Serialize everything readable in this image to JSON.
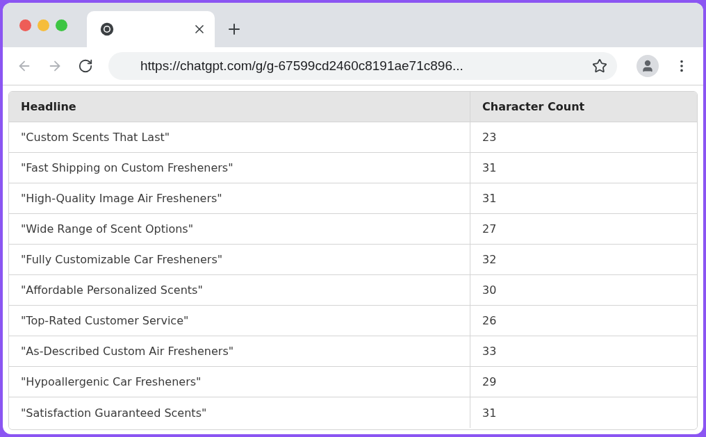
{
  "browser": {
    "tabs": [
      {
        "selected": true
      }
    ],
    "address": "https://chatgpt.com/g/g-67599cd2460c8191ae71c896..."
  },
  "table": {
    "columns": [
      "Headline",
      "Character Count"
    ],
    "rows": [
      [
        "\"Custom Scents That Last\"",
        "23"
      ],
      [
        "\"Fast Shipping on Custom Fresheners\"",
        "31"
      ],
      [
        "\"High-Quality Image Air Fresheners\"",
        "31"
      ],
      [
        "\"Wide Range of Scent Options\"",
        "27"
      ],
      [
        "\"Fully Customizable Car Fresheners\"",
        "32"
      ],
      [
        "\"Affordable Personalized Scents\"",
        "30"
      ],
      [
        "\"Top-Rated Customer Service\"",
        "26"
      ],
      [
        "\"As-Described Custom Air Fresheners\"",
        "33"
      ],
      [
        "\"Hypoallergenic Car Fresheners\"",
        "29"
      ],
      [
        "\"Satisfaction Guaranteed Scents\"",
        "31"
      ]
    ]
  }
}
